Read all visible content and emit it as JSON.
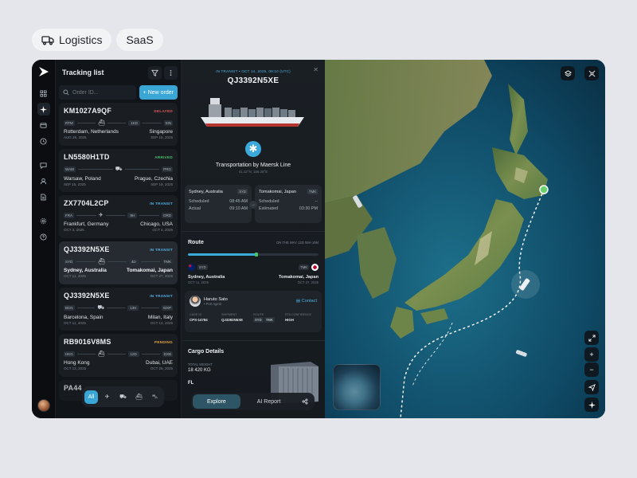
{
  "tags": [
    {
      "label": "Logistics",
      "icon": "truck-icon"
    },
    {
      "label": "SaaS",
      "icon": ""
    }
  ],
  "sidebar": {
    "icons": [
      "grid-icon",
      "tracking-icon",
      "card-icon",
      "clock-icon",
      "chat-icon",
      "users-icon",
      "document-icon",
      "settings-icon",
      "help-icon"
    ],
    "active_index": 1
  },
  "tracking": {
    "title": "Tracking list",
    "search_placeholder": "Order ID...",
    "new_order_label": "+ New order",
    "orders": [
      {
        "id": "KM1027A9QF",
        "status": "DELAYED",
        "status_color": "#e0555a",
        "from_code": "RTM",
        "to_code": "SIN",
        "mid": "1KD",
        "vehicle": "ship",
        "from_city": "Rotterdam, Netherlands",
        "to_city": "Singapore",
        "from_date": "AUG 28, 2025",
        "to_date": "SEP 15, 2025"
      },
      {
        "id": "LN5580H1TD",
        "status": "ARRIVED",
        "status_color": "#4ac26b",
        "from_code": "WAW",
        "to_code": "PRG",
        "mid": "",
        "vehicle": "truck",
        "from_city": "Warsaw, Poland",
        "to_city": "Prague, Czechia",
        "from_date": "SEP 15, 2025",
        "to_date": "SEP 19, 2025"
      },
      {
        "id": "ZX7704L2CP",
        "status": "IN TRANSIT",
        "status_color": "#4fb3e6",
        "from_code": "FRA",
        "to_code": "ORD",
        "mid": "9H",
        "vehicle": "plane",
        "from_city": "Frankfurt, Germany",
        "to_city": "Chicago, USA",
        "from_date": "OCT 3, 2025",
        "to_date": "OCT 4, 2025"
      },
      {
        "id": "QJ3392N5XE",
        "status": "IN TRANSIT",
        "status_color": "#4fb3e6",
        "from_code": "SYD",
        "to_code": "TMK",
        "mid": "4D",
        "vehicle": "ship",
        "from_city": "Sydney, Australia",
        "to_city": "Tomakomai, Japan",
        "from_date": "OCT 11, 2025",
        "to_date": "OCT 27, 2025"
      },
      {
        "id": "QJ3392N5XE",
        "status": "IN TRANSIT",
        "status_color": "#4fb3e6",
        "from_code": "BCN",
        "to_code": "MXP",
        "mid": "13H",
        "vehicle": "truck",
        "from_city": "Barcelona, Spain",
        "to_city": "Milan, Italy",
        "from_date": "OCT 11, 2025",
        "to_date": "OCT 13, 2025"
      },
      {
        "id": "RB9016V8MS",
        "status": "PENDING",
        "status_color": "#e3a33b",
        "from_code": "HKG",
        "to_code": "DXB",
        "mid": "12D",
        "vehicle": "ship",
        "from_city": "Hong Kong",
        "to_city": "Dubai, UAE",
        "from_date": "OCT 13, 2025",
        "to_date": "OCT 25, 2025"
      }
    ],
    "partial_id": "PA44",
    "filters": [
      "All",
      "plane-icon",
      "truck-icon",
      "ship-icon",
      "van-icon"
    ]
  },
  "detail": {
    "status_line": "IN TRANSIT • OCT 14, 2025, 09:10 (UTC)",
    "id": "QJ3392N5XE",
    "carrier": "Transportation by Maersk Line",
    "coords": "41.12°N, 155.28°E",
    "origin": {
      "city": "Sydney, Australia",
      "code": "SYD",
      "scheduled_label": "Scheduled",
      "scheduled": "08:45 AM",
      "actual_label": "Actual",
      "actual": "09:10 AM"
    },
    "destination": {
      "city": "Tomakomai, Japan",
      "code": "TMK",
      "scheduled_label": "Scheduled",
      "scheduled": "--",
      "estimated_label": "Estimated",
      "estimated": "03:30 PM"
    },
    "route": {
      "title": "Route",
      "meta": "ON THE WAY  12D 06H 10M",
      "progress": 0.52,
      "from_code": "SYD",
      "to_code": "TMK",
      "from_city": "Sydney, Australia",
      "to_city": "Tomakomai, Japan",
      "from_date": "OCT 11, 2025",
      "to_date": "OCT 27, 2025"
    },
    "agent": {
      "name": "Haruto Sato",
      "role": "• Port Agent",
      "contact_label": "Contact",
      "case_label": "CASE ID",
      "case": "CPS-14784",
      "shipment_label": "SHIPMENT",
      "shipment": "QJ3392N5XE",
      "route_label": "ROUTE",
      "route_from": "SYD",
      "route_to": "TMK",
      "eta_label": "ETA CONFIDENCE",
      "eta": "HIGH"
    },
    "cargo": {
      "title": "Cargo Details",
      "weight_label": "TOTAL WEIGHT",
      "weight": "18 420 KG",
      "partial": "FL"
    },
    "actions": {
      "explore": "Explore",
      "ai_report": "AI Report"
    }
  },
  "map": {
    "controls_top": [
      "layers-icon",
      "satellite-icon"
    ],
    "controls_right": [
      "expand-icon",
      "+",
      "−",
      "navigate-icon",
      "compass-icon"
    ],
    "colors": {
      "ocean": "#0f3e57",
      "land": "#6f8a4a",
      "route": "#ffffff",
      "marker": "#6ad36a"
    }
  }
}
